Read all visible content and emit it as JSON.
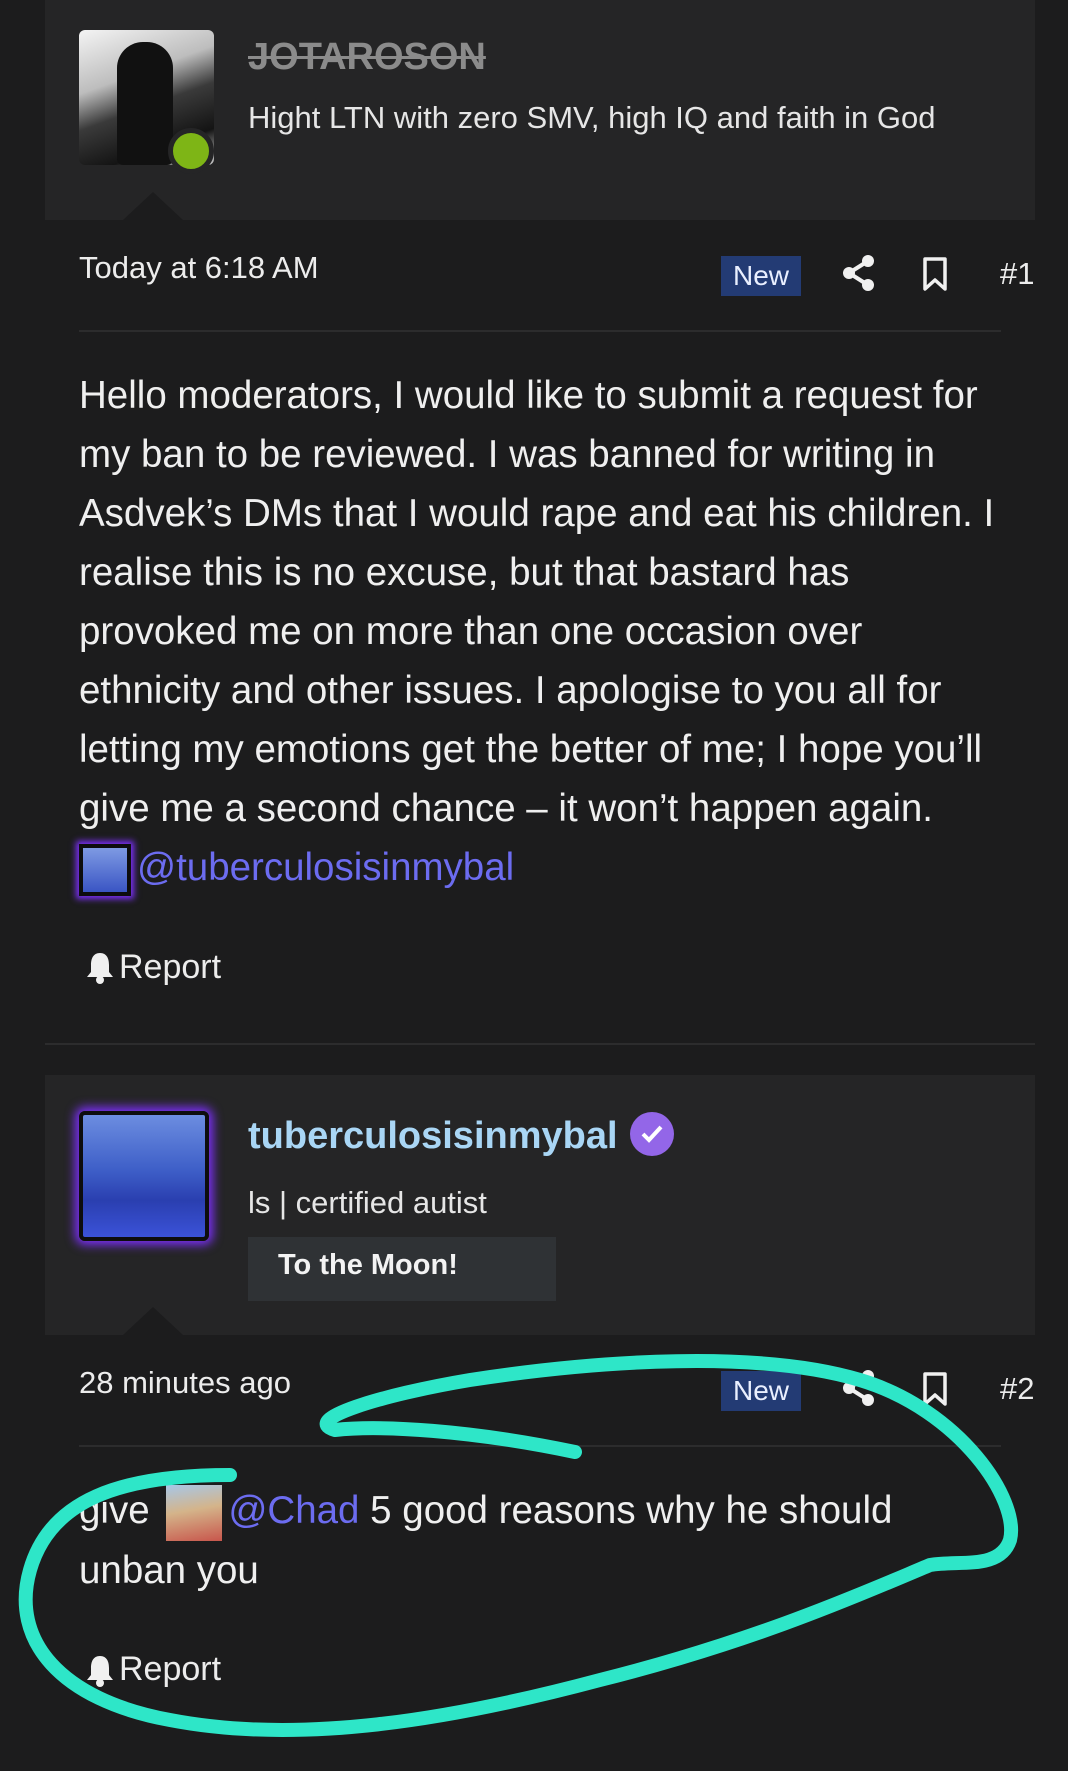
{
  "post1": {
    "username": "JOTAROSON",
    "user_title": "Hight LTN with zero SMV, high IQ and faith in God",
    "timestamp": "Today at 6:18 AM",
    "badge": "New",
    "post_number": "#1",
    "body": "Hello moderators, I would like to submit a request for my ban to be reviewed. I was banned for writing in Asdvek’s DMs that I would rape and eat his children. I realise this is no excuse, but that bastard has provoked me on more than one occasion over ethnicity and other issues. I apologise to you all for letting my emotions get the better of me; I hope you’ll give me a second chance – it won’t happen again.",
    "mention": "@tuberculosisinmybal",
    "report_label": "Report"
  },
  "post2": {
    "username": "tuberculosisinmybal",
    "user_title": "ls | certified autist",
    "trophy": "To the Moon!",
    "timestamp": "28 minutes ago",
    "badge": "New",
    "post_number": "#2",
    "body_before": "give",
    "mention": "@Chad",
    "body_after": "5 good reasons why he should unban you",
    "report_label": "Report"
  },
  "colors": {
    "background": "#1c1c1d",
    "panel": "#252526",
    "badge_new": "#233b74",
    "mention": "#6c6cf0",
    "online": "#7eb516",
    "annotation_stroke": "#2ee6c8",
    "verified": "#9366e8"
  },
  "icons": [
    "share-icon",
    "bookmark-icon",
    "bell-icon",
    "verified-icon"
  ]
}
